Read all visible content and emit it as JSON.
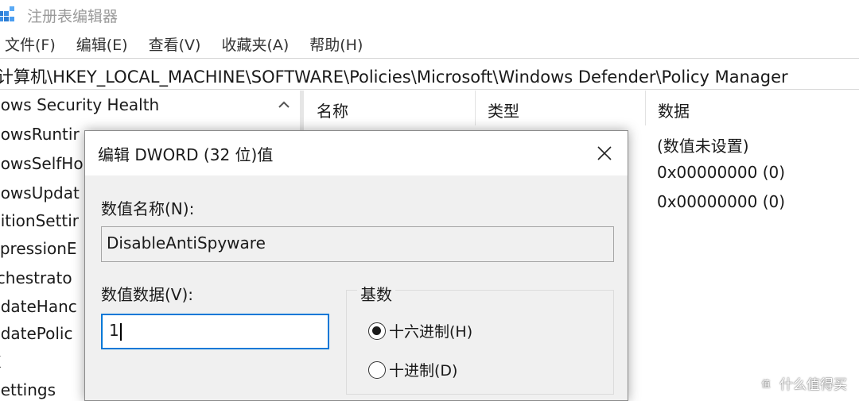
{
  "window": {
    "title": "注册表编辑器",
    "icon": "regedit-icon"
  },
  "menu": [
    "文件(F)",
    "编辑(E)",
    "查看(V)",
    "收藏夹(A)",
    "帮助(H)"
  ],
  "address": "计算机\\HKEY_LOCAL_MACHINE\\SOFTWARE\\Policies\\Microsoft\\Windows Defender\\Policy Manager",
  "tree": {
    "items": [
      "dows Security Health",
      "dowsRuntir",
      "dowsSelfHo",
      "dowsUpdat",
      "ditionSettir",
      "xpressionE",
      "rchestrato",
      "pdateHanc",
      "pdatePolic",
      "X",
      " Settings"
    ]
  },
  "list": {
    "columns": [
      "名称",
      "类型",
      "数据"
    ],
    "data_values": [
      "(数值未设置)",
      "0x00000000 (0)",
      "0x00000000 (0)"
    ]
  },
  "dialog": {
    "title": "编辑 DWORD (32 位)值",
    "name_label": "数值名称(N):",
    "name_value": "DisableAntiSpyware",
    "data_label": "数值数据(V):",
    "data_value": "1",
    "base_label": "基数",
    "base_options": [
      {
        "label": "十六进制(H)",
        "selected": true
      },
      {
        "label": "十进制(D)",
        "selected": false
      }
    ]
  },
  "watermark": {
    "text": "什么值得买"
  },
  "colors": {
    "focus_border": "#0078d7",
    "dialog_bg": "#f0f0f0"
  }
}
